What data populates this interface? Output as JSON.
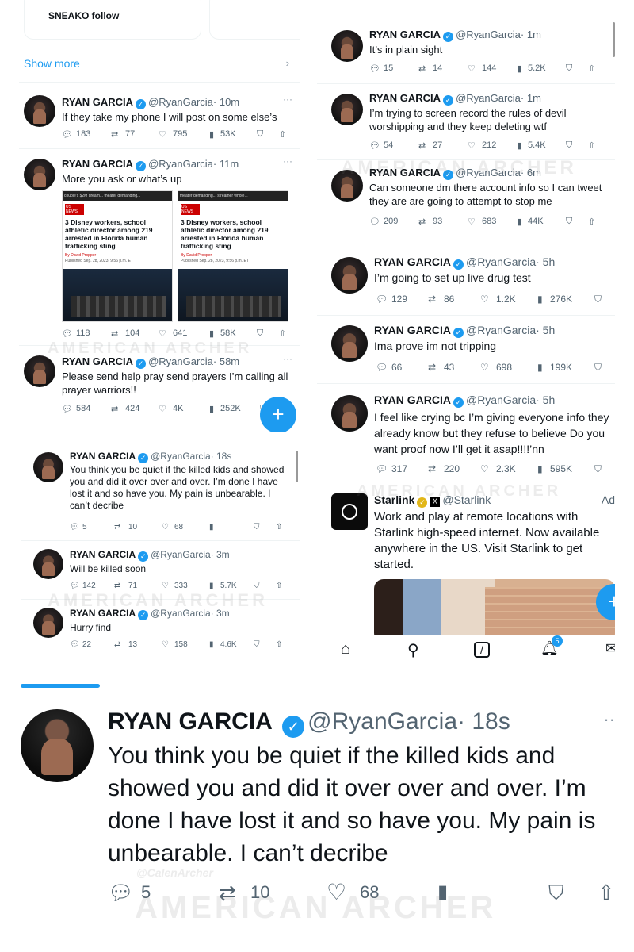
{
  "colors": {
    "accent": "#1d9bf0",
    "text": "#0f1419",
    "muted": "#536471"
  },
  "watermark": {
    "text": "AMERICAN ARCHER",
    "handle": "@CalenArcher"
  },
  "left_top": {
    "follow_card": "SNEAKO follow",
    "show_more": "Show more"
  },
  "tweets": [
    {
      "name": "RYAN GARCIA",
      "handle": "@RyanGarcia",
      "time": "· 10m",
      "text": "If they take my phone I will post on some else’s",
      "replies": "183",
      "retweets": "77",
      "likes": "795",
      "views": "53K"
    },
    {
      "name": "RYAN GARCIA",
      "handle": "@RyanGarcia",
      "time": "· 11m",
      "text": "More you ask or what’s up",
      "replies": "118",
      "retweets": "104",
      "likes": "641",
      "views": "58K",
      "article": {
        "top_tabs": [
          "couple's $2M dream...",
          "theater demanding...",
          "streamer whole..."
        ],
        "tag": "US NEWS",
        "headline": "3 Disney workers, school athletic director among 219 arrested in Florida human trafficking sting",
        "byline": "By David Propper",
        "date": "Published Sep. 28, 2023, 9:56 p.m. ET"
      }
    },
    {
      "name": "RYAN GARCIA",
      "handle": "@RyanGarcia",
      "time": "· 58m",
      "text": "Please send help pray send prayers I’m calling all prayer warriors!!",
      "replies": "584",
      "retweets": "424",
      "likes": "4K",
      "views": "252K"
    },
    {
      "name": "RYAN GARCIA",
      "handle": "@RyanGarcia",
      "time": "· 18s",
      "text": "You think you be quiet if the killed kids and showed you and did it over over and over. I’m done I have lost it and so have you. My pain is unbearable. I can’t decribe",
      "replies": "5",
      "retweets": "10",
      "likes": "68",
      "views": ""
    },
    {
      "name": "RYAN GARCIA",
      "handle": "@RyanGarcia",
      "time": "· 3m",
      "text": "Will be killed soon",
      "replies": "142",
      "retweets": "71",
      "likes": "333",
      "views": "5.7K"
    },
    {
      "name": "RYAN GARCIA",
      "handle": "@RyanGarcia",
      "time": "· 3m",
      "text": "Hurry find",
      "replies": "22",
      "retweets": "13",
      "likes": "158",
      "views": "4.6K"
    },
    {
      "name": "RYAN GARCIA",
      "handle": "@RyanGarcia",
      "time": "· 1m",
      "text": "It’s in plain sight",
      "replies": "15",
      "retweets": "14",
      "likes": "144",
      "views": "5.2K"
    },
    {
      "name": "RYAN GARCIA",
      "handle": "@RyanGarcia",
      "time": "· 1m",
      "text": "I’m trying to screen record the rules of devil worshipping and they keep deleting wtf",
      "replies": "54",
      "retweets": "27",
      "likes": "212",
      "views": "5.4K"
    },
    {
      "name": "RYAN GARCIA",
      "handle": "@RyanGarcia",
      "time": "· 6m",
      "text": "Can someone dm there account info so I can tweet they are are going to attempt to stop me",
      "replies": "209",
      "retweets": "93",
      "likes": "683",
      "views": "44K"
    },
    {
      "name": "RYAN GARCIA",
      "handle": "@RyanGarcia",
      "time": "· 5h",
      "text": "I’m going to set up live drug test",
      "replies": "129",
      "retweets": "86",
      "likes": "1.2K",
      "views": "276K"
    },
    {
      "name": "RYAN GARCIA",
      "handle": "@RyanGarcia",
      "time": "· 5h",
      "text": "Ima prove im not tripping",
      "replies": "66",
      "retweets": "43",
      "likes": "698",
      "views": "199K"
    },
    {
      "name": "RYAN GARCIA",
      "handle": "@RyanGarcia",
      "time": "· 5h",
      "text": "I feel like crying bc I’m giving everyone info they already know but they refuse to believe Do you want proof now I’ll get it asap!!!!’nn",
      "replies": "317",
      "retweets": "220",
      "likes": "2.3K",
      "views": "595K"
    }
  ],
  "ad": {
    "name": "Starlink",
    "handle": "@Starlink",
    "label": "Ad",
    "text": "Work and play at remote locations with Starlink high-speed internet. Now available anywhere in the US. Visit Starlink to get started."
  },
  "nav": {
    "notifications_badge": "5"
  },
  "zoom": {
    "name": "RYAN GARCIA",
    "handle": "@RyanGarcia",
    "time": "· 18s",
    "text": "You think you be quiet if the killed kids and showed you and did it over over and over. I’m done I have lost it and so have you. My pain is unbearable. I can’t decribe",
    "replies": "5",
    "retweets": "10",
    "likes": "68"
  }
}
